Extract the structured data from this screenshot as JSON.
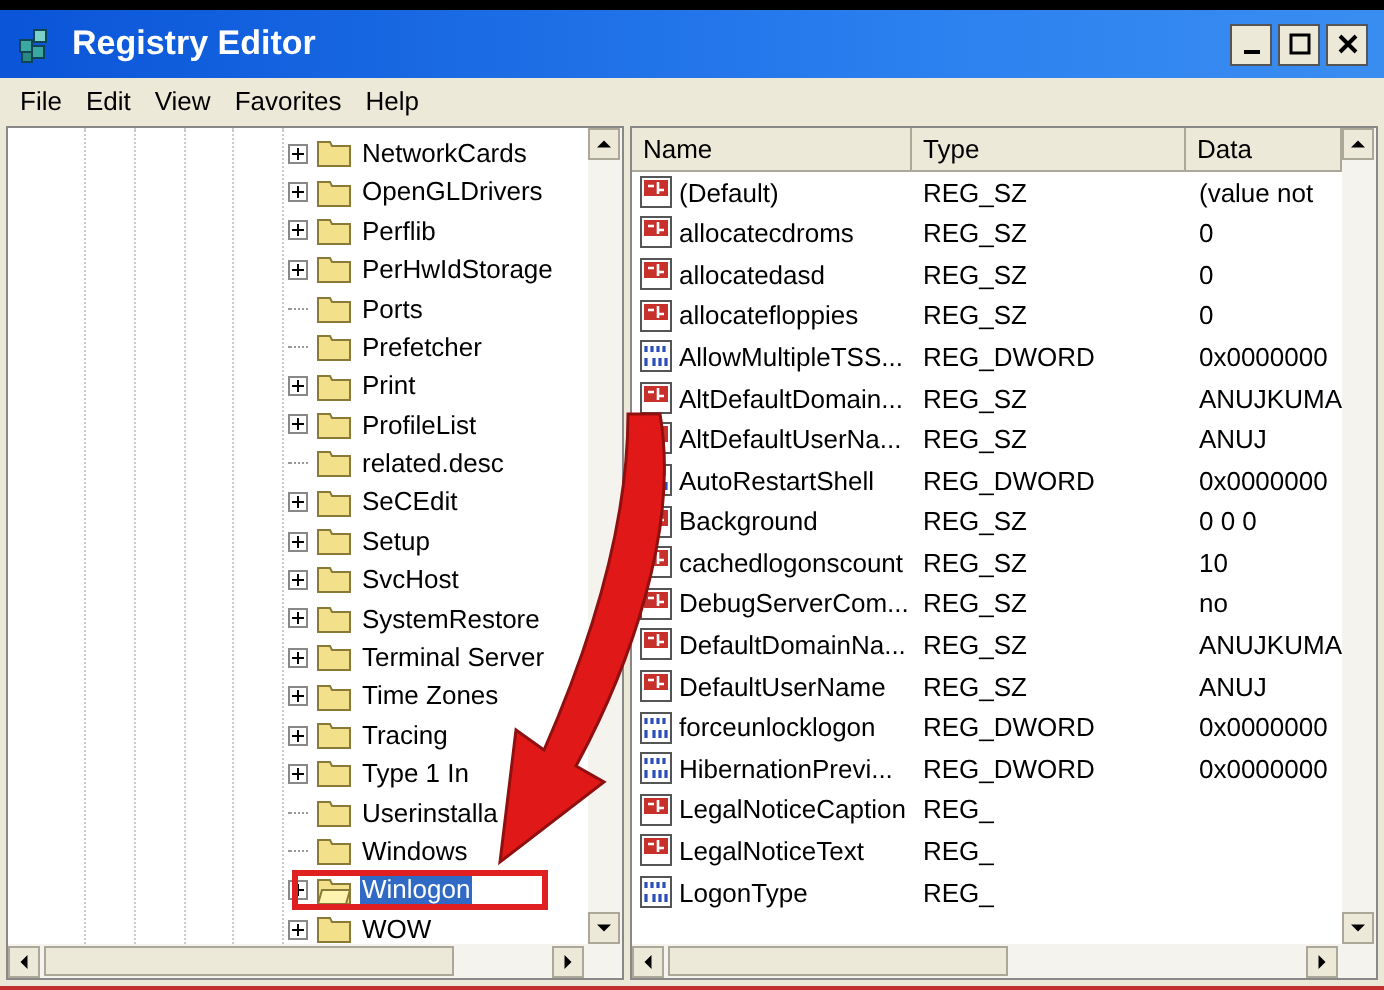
{
  "window": {
    "title": "Registry Editor"
  },
  "menu": [
    "File",
    "Edit",
    "View",
    "Favorites",
    "Help"
  ],
  "tree": [
    {
      "label": "NetworkCards",
      "expandable": true,
      "selected": false
    },
    {
      "label": "OpenGLDrivers",
      "expandable": true,
      "selected": false
    },
    {
      "label": "Perflib",
      "expandable": true,
      "selected": false
    },
    {
      "label": "PerHwIdStorage",
      "expandable": true,
      "selected": false
    },
    {
      "label": "Ports",
      "expandable": false,
      "selected": false
    },
    {
      "label": "Prefetcher",
      "expandable": false,
      "selected": false
    },
    {
      "label": "Print",
      "expandable": true,
      "selected": false
    },
    {
      "label": "ProfileList",
      "expandable": true,
      "selected": false
    },
    {
      "label": "related.desc",
      "expandable": false,
      "selected": false
    },
    {
      "label": "SeCEdit",
      "expandable": true,
      "selected": false
    },
    {
      "label": "Setup",
      "expandable": true,
      "selected": false
    },
    {
      "label": "SvcHost",
      "expandable": true,
      "selected": false
    },
    {
      "label": "SystemRestore",
      "expandable": true,
      "selected": false
    },
    {
      "label": "Terminal Server",
      "expandable": true,
      "selected": false
    },
    {
      "label": "Time Zones",
      "expandable": true,
      "selected": false
    },
    {
      "label": "Tracing",
      "expandable": true,
      "selected": false
    },
    {
      "label": "Type 1 In",
      "expandable": true,
      "selected": false
    },
    {
      "label": "Userinstalla",
      "expandable": false,
      "selected": false
    },
    {
      "label": "Windows",
      "expandable": false,
      "selected": false
    },
    {
      "label": "Winlogon",
      "expandable": true,
      "selected": true
    },
    {
      "label": "WOW",
      "expandable": true,
      "selected": false
    }
  ],
  "table": {
    "columns": [
      "Name",
      "Type",
      "Data"
    ],
    "rows": [
      {
        "kind": "string",
        "name": "(Default)",
        "type": "REG_SZ",
        "data": "(value not"
      },
      {
        "kind": "string",
        "name": "allocatecdroms",
        "type": "REG_SZ",
        "data": "0"
      },
      {
        "kind": "string",
        "name": "allocatedasd",
        "type": "REG_SZ",
        "data": "0"
      },
      {
        "kind": "string",
        "name": "allocatefloppies",
        "type": "REG_SZ",
        "data": "0"
      },
      {
        "kind": "dword",
        "name": "AllowMultipleTSS...",
        "type": "REG_DWORD",
        "data": "0x0000000"
      },
      {
        "kind": "string",
        "name": "AltDefaultDomain...",
        "type": "REG_SZ",
        "data": "ANUJKUMA"
      },
      {
        "kind": "string",
        "name": "AltDefaultUserNa...",
        "type": "REG_SZ",
        "data": "ANUJ"
      },
      {
        "kind": "dword",
        "name": "AutoRestartShell",
        "type": "REG_DWORD",
        "data": "0x0000000"
      },
      {
        "kind": "string",
        "name": "Background",
        "type": "REG_SZ",
        "data": "0 0 0"
      },
      {
        "kind": "string",
        "name": "cachedlogonscount",
        "type": "REG_SZ",
        "data": "10"
      },
      {
        "kind": "string",
        "name": "DebugServerCom...",
        "type": "REG_SZ",
        "data": "no"
      },
      {
        "kind": "string",
        "name": "DefaultDomainNa...",
        "type": "REG_SZ",
        "data": "ANUJKUMA"
      },
      {
        "kind": "string",
        "name": "DefaultUserName",
        "type": "REG_SZ",
        "data": "ANUJ"
      },
      {
        "kind": "dword",
        "name": "forceunlocklogon",
        "type": "REG_DWORD",
        "data": "0x0000000"
      },
      {
        "kind": "dword",
        "name": "HibernationPrevi...",
        "type": "REG_DWORD",
        "data": "0x0000000"
      },
      {
        "kind": "string",
        "name": "LegalNoticeCaption",
        "type": "REG_"
      },
      {
        "kind": "string",
        "name": "LegalNoticeText",
        "type": "REG_"
      },
      {
        "kind": "dword",
        "name": "LogonType",
        "type": "REG_"
      }
    ]
  }
}
